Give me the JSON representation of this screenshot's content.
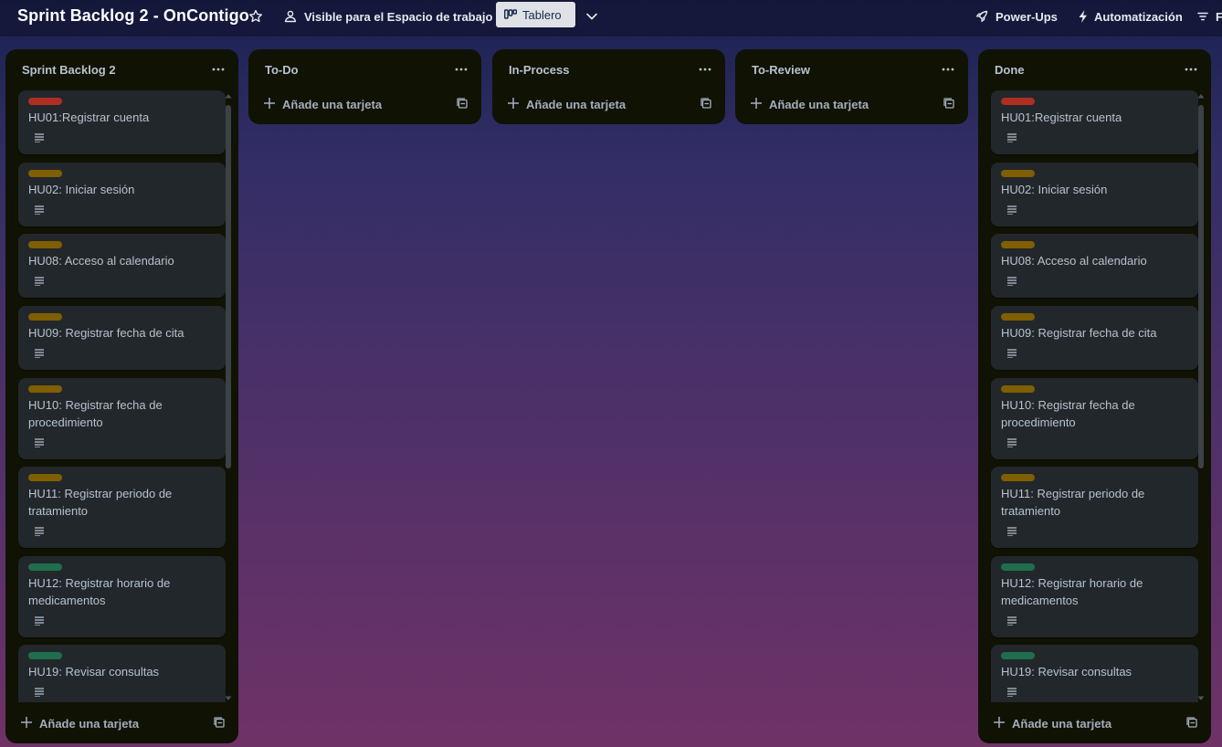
{
  "board": {
    "title": "Sprint Backlog 2 - OnContigo",
    "visibility_label": "Visible para el Espacio de trabajo",
    "view_label": "Tablero",
    "powerups_label": "Power-Ups",
    "automation_label": "Automatización",
    "filter_label": "F"
  },
  "colors": {
    "label_red": "#ae2e24",
    "label_yellow": "#7f5f01",
    "label_green": "#216e4e",
    "list_bg": "#101204",
    "card_bg": "#22272b"
  },
  "icons": {
    "star": "star-icon",
    "visibility": "workspace-people-icon",
    "view": "board-icon",
    "views_menu": "chevron-down-icon",
    "powerups": "rocket-icon",
    "automation": "lightning-icon",
    "filter": "filter-icon",
    "list_menu": "ellipsis-icon",
    "add": "plus-icon",
    "template": "card-template-icon",
    "description": "description-icon"
  },
  "lists": [
    {
      "title": "Sprint Backlog 2",
      "add_label": "Añade una tarjeta",
      "cards": [
        {
          "label": "red",
          "title": "HU01:Registrar cuenta"
        },
        {
          "label": "yellow",
          "title": "HU02: Iniciar sesión"
        },
        {
          "label": "yellow",
          "title": "HU08: Acceso al calendario"
        },
        {
          "label": "yellow",
          "title": "HU09: Registrar fecha de cita"
        },
        {
          "label": "yellow",
          "title": "HU10: Registrar fecha de procedimiento"
        },
        {
          "label": "yellow",
          "title": "HU11: Registrar periodo de tratamiento"
        },
        {
          "label": "green",
          "title": "HU12: Registrar horario de medicamentos"
        },
        {
          "label": "green",
          "title": "HU19: Revisar consultas"
        }
      ]
    },
    {
      "title": "To-Do",
      "add_label": "Añade una tarjeta",
      "cards": []
    },
    {
      "title": "In-Process",
      "add_label": "Añade una tarjeta",
      "cards": []
    },
    {
      "title": "To-Review",
      "add_label": "Añade una tarjeta",
      "cards": []
    },
    {
      "title": "Done",
      "add_label": "Añade una tarjeta",
      "cards": [
        {
          "label": "red",
          "title": "HU01:Registrar cuenta"
        },
        {
          "label": "yellow",
          "title": "HU02: Iniciar sesión"
        },
        {
          "label": "yellow",
          "title": "HU08: Acceso al calendario"
        },
        {
          "label": "yellow",
          "title": "HU09: Registrar fecha de cita"
        },
        {
          "label": "yellow",
          "title": "HU10: Registrar fecha de procedimiento"
        },
        {
          "label": "yellow",
          "title": "HU11: Registrar periodo de tratamiento"
        },
        {
          "label": "green",
          "title": "HU12: Registrar horario de medicamentos"
        },
        {
          "label": "green",
          "title": "HU19: Revisar consultas"
        }
      ]
    }
  ]
}
